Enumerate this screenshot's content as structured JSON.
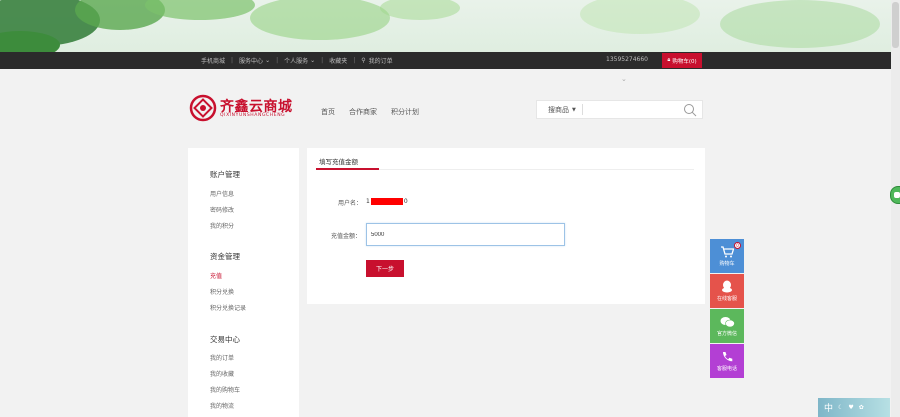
{
  "topbar": {
    "links": [
      "手机商城",
      "服务中心",
      "个人服务",
      "收藏夹",
      "我的订单"
    ],
    "phone": "13595274660",
    "cart_label": "购物车(0)"
  },
  "header": {
    "brand_name": "齐鑫云商城",
    "brand_sub": "QIXINYUNSHANGCHENG",
    "nav": [
      "首页",
      "合作商家",
      "积分计划"
    ],
    "search_scope": "搜商品",
    "search_placeholder": ""
  },
  "sidebar": {
    "groups": [
      {
        "title": "账户管理",
        "items": [
          "用户信息",
          "密码修改",
          "我的积分"
        ]
      },
      {
        "title": "资金管理",
        "items": [
          "充值",
          "积分兑换",
          "积分兑换记录"
        ]
      },
      {
        "title": "交易中心",
        "items": [
          "我的订单",
          "我的收藏",
          "我的购物车",
          "我的物流"
        ]
      }
    ],
    "active_item": "充值"
  },
  "main": {
    "tab_title": "填写充值金额",
    "username_label": "用户名：",
    "username_prefix": "1",
    "username_suffix": "0",
    "amount_label": "充值金额：",
    "amount_value": "5000",
    "next_button": "下一步"
  },
  "float_tools": [
    {
      "label": "购物车",
      "color": "#4d8fd6",
      "icon": "cart-icon",
      "badge": "0"
    },
    {
      "label": "在线客服",
      "color": "#e5534b",
      "icon": "qq-icon"
    },
    {
      "label": "官方微信",
      "color": "#5cb85c",
      "icon": "wechat-icon"
    },
    {
      "label": "客服电话",
      "color": "#b33fd4",
      "icon": "phone-icon"
    }
  ],
  "ime": {
    "char": "中"
  }
}
